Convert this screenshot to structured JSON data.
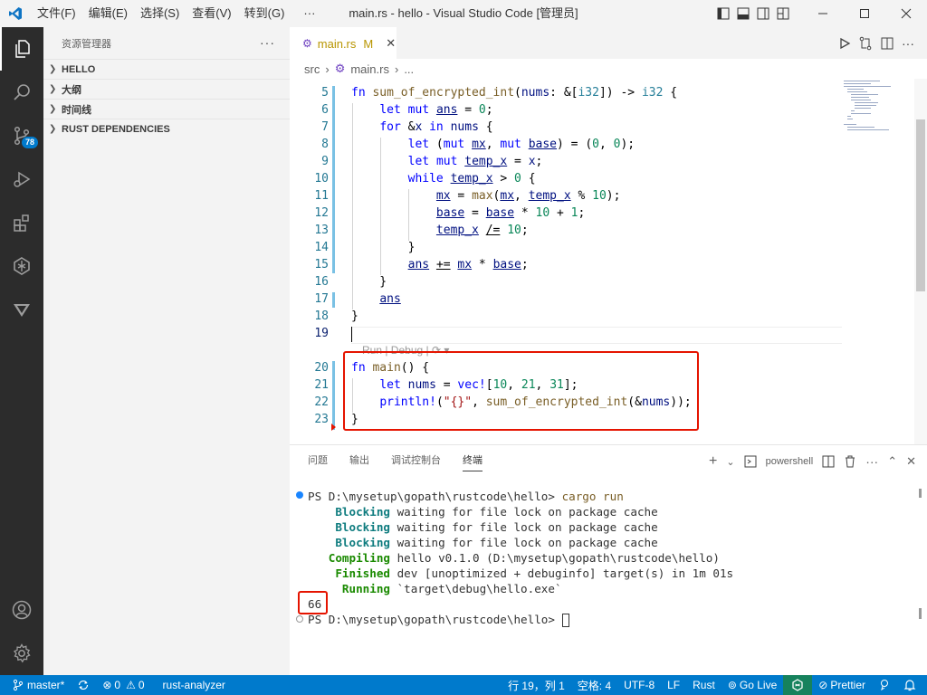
{
  "window": {
    "title": "main.rs - hello - Visual Studio Code [管理员]",
    "menu": [
      "文件(F)",
      "编辑(E)",
      "选择(S)",
      "查看(V)",
      "转到(G)",
      "···"
    ]
  },
  "activity": {
    "source_control_badge": "78"
  },
  "sidebar": {
    "header": "资源管理器",
    "sections": [
      "HELLO",
      "大纲",
      "时间线",
      "RUST DEPENDENCIES"
    ]
  },
  "editor": {
    "tab": {
      "filename": "main.rs",
      "modified": "M"
    },
    "breadcrumb": [
      "src",
      "main.rs",
      "..."
    ],
    "codelens": "Run | Debug | ⟳ ▾",
    "line_numbers": [
      "5",
      "6",
      "7",
      "8",
      "9",
      "10",
      "11",
      "12",
      "13",
      "14",
      "15",
      "16",
      "17",
      "18",
      "19",
      "20",
      "21",
      "22",
      "23"
    ]
  },
  "panel": {
    "tabs": [
      "问题",
      "输出",
      "调试控制台",
      "终端"
    ],
    "active_tab": "终端",
    "shell": "powershell",
    "prompt1": "PS D:\\mysetup\\gopath\\rustcode\\hello>",
    "cmd": "cargo run",
    "lines": [
      {
        "tag": "Blocking",
        "text": " waiting for file lock on package cache"
      },
      {
        "tag": "Blocking",
        "text": " waiting for file lock on package cache"
      },
      {
        "tag": "Blocking",
        "text": " waiting for file lock on package cache"
      },
      {
        "tag": "Compiling",
        "text": " hello v0.1.0 (D:\\mysetup\\gopath\\rustcode\\hello)"
      },
      {
        "tag": "Finished",
        "text": " dev [unoptimized + debuginfo] target(s) in 1m 01s"
      },
      {
        "tag": "Running",
        "text": " `target\\debug\\hello.exe`"
      }
    ],
    "output": "66",
    "prompt2": "PS D:\\mysetup\\gopath\\rustcode\\hello>"
  },
  "status": {
    "branch": "master*",
    "errors": "0",
    "warnings": "0",
    "analyzer": "rust-analyzer",
    "position": "行 19，列 1",
    "spaces": "空格: 4",
    "encoding": "UTF-8",
    "eol": "LF",
    "language": "Rust",
    "golive": "Go Live",
    "prettier": "Prettier"
  },
  "colors": {
    "accent": "#007acc",
    "highlight_box": "#e51400",
    "activity_bg": "#2c2c2c"
  }
}
